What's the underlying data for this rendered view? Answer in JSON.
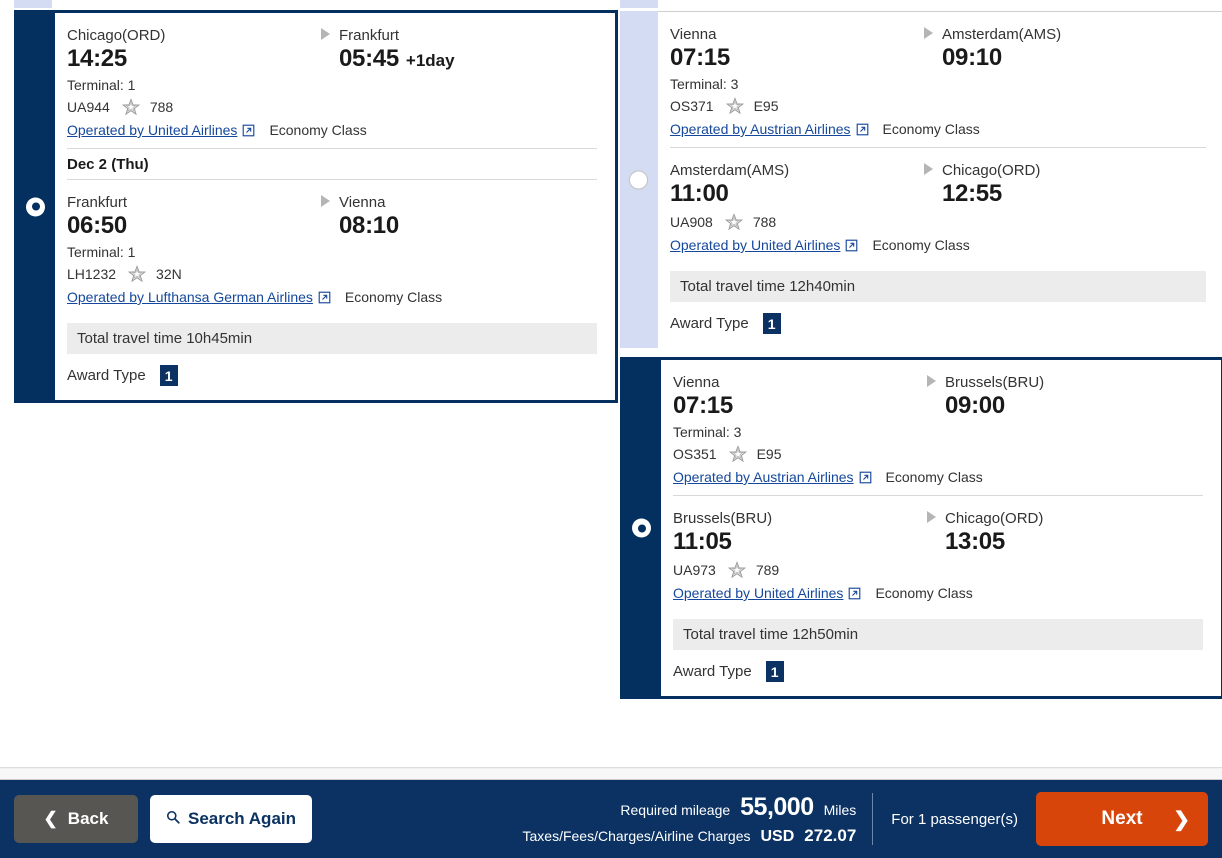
{
  "colors": {
    "brand_navy": "#0b3263",
    "card_selected_border": "#04305f",
    "strip_unselected": "#d3dcf2",
    "link_blue": "#15489c",
    "next_orange": "#d8450b",
    "back_gray": "#575653",
    "total_bar_gray": "#ececec"
  },
  "itineraries": [
    {
      "column": "left",
      "selected": true,
      "radio_name": "outbound-itinerary-radio",
      "segments": [
        {
          "from_city": "Chicago(ORD)",
          "to_city": "Frankfurt",
          "depart_time": "14:25",
          "arrive_time": "05:45",
          "day_offset": "+1day",
          "terminal": "Terminal: 1",
          "flight_no": "UA944",
          "equipment": "788",
          "operator": "Operated by United Airlines",
          "cabin": "Economy Class"
        },
        {
          "date_header": "Dec 2 (Thu)",
          "from_city": "Frankfurt",
          "to_city": "Vienna",
          "depart_time": "06:50",
          "arrive_time": "08:10",
          "day_offset": "",
          "terminal": "Terminal: 1",
          "flight_no": "LH1232",
          "equipment": "32N",
          "operator": "Operated by Lufthansa German Airlines",
          "cabin": "Economy Class"
        }
      ],
      "total_travel_time": "Total travel time 10h45min",
      "award_label": "Award Type",
      "award_badge": "1"
    },
    {
      "column": "right",
      "selected": false,
      "radio_name": "return-itinerary-radio-1",
      "segments": [
        {
          "from_city": "Vienna",
          "to_city": "Amsterdam(AMS)",
          "depart_time": "07:15",
          "arrive_time": "09:10",
          "day_offset": "",
          "terminal": "Terminal: 3",
          "flight_no": "OS371",
          "equipment": "E95",
          "operator": "Operated by Austrian Airlines",
          "cabin": "Economy Class"
        },
        {
          "from_city": "Amsterdam(AMS)",
          "to_city": "Chicago(ORD)",
          "depart_time": "11:00",
          "arrive_time": "12:55",
          "day_offset": "",
          "terminal": "",
          "flight_no": "UA908",
          "equipment": "788",
          "operator": "Operated by United Airlines",
          "cabin": "Economy Class"
        }
      ],
      "total_travel_time": "Total travel time 12h40min",
      "award_label": "Award Type",
      "award_badge": "1"
    },
    {
      "column": "right",
      "selected": true,
      "radio_name": "return-itinerary-radio-2",
      "segments": [
        {
          "from_city": "Vienna",
          "to_city": "Brussels(BRU)",
          "depart_time": "07:15",
          "arrive_time": "09:00",
          "day_offset": "",
          "terminal": "Terminal: 3",
          "flight_no": "OS351",
          "equipment": "E95",
          "operator": "Operated by Austrian Airlines",
          "cabin": "Economy Class"
        },
        {
          "from_city": "Brussels(BRU)",
          "to_city": "Chicago(ORD)",
          "depart_time": "11:05",
          "arrive_time": "13:05",
          "day_offset": "",
          "terminal": "",
          "flight_no": "UA973",
          "equipment": "789",
          "operator": "Operated by United Airlines",
          "cabin": "Economy Class"
        }
      ],
      "total_travel_time": "Total travel time 12h50min",
      "award_label": "Award Type",
      "award_badge": "1"
    }
  ],
  "bottom_bar": {
    "back_label": "Back",
    "search_again_label": "Search Again",
    "required_mileage_label": "Required mileage",
    "mileage_value": "55,000",
    "mileage_unit": "Miles",
    "taxes_label": "Taxes/Fees/Charges/Airline Charges",
    "currency": "USD",
    "amount": "272.07",
    "passengers_label": "For 1 passenger(s)",
    "next_label": "Next"
  },
  "icons": {
    "star_alliance": "star-alliance-icon",
    "external_link": "external-link-icon",
    "arrow_right_triangle": "arrow-right-triangle-icon",
    "search": "search-icon",
    "chevron_left": "chevron-left-icon",
    "chevron_right": "chevron-right-icon"
  }
}
